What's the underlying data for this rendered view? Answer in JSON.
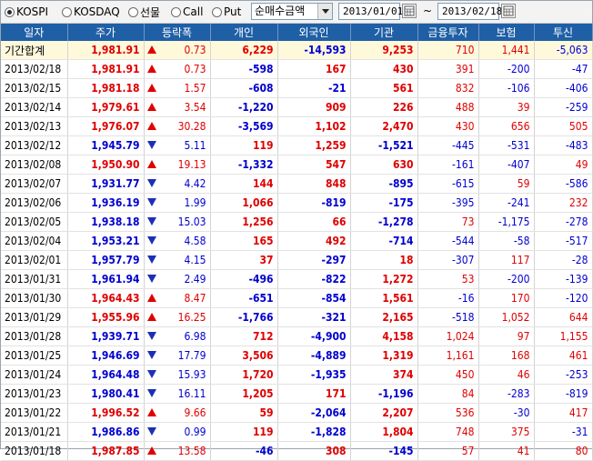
{
  "toolbar": {
    "markets": [
      {
        "label": "KOSPI",
        "selected": true
      },
      {
        "label": "KOSDAQ",
        "selected": false
      },
      {
        "label": "선물",
        "selected": false
      },
      {
        "label": "Call",
        "selected": false
      },
      {
        "label": "Put",
        "selected": false
      }
    ],
    "view_select": "순매수금액",
    "date_from": "2013/01/01",
    "date_sep": "~",
    "date_to": "2013/02/18"
  },
  "columns": [
    "일자",
    "주가",
    "등락폭",
    "개인",
    "외국인",
    "기관",
    "금융투자",
    "보험",
    "투신"
  ],
  "colors": {
    "up": "#e00000",
    "down": "#0000d0",
    "header_bg": "#1f5fa6",
    "total_bg": "#fff9dc"
  },
  "rows": [
    {
      "date": "기간합계",
      "price": "1,981.91",
      "dir": "up",
      "chg": "0.73",
      "indiv": "6,229",
      "foreign": "-14,593",
      "inst": "9,253",
      "fin": "710",
      "ins": "1,441",
      "trust": "-5,063"
    },
    {
      "date": "2013/02/18",
      "price": "1,981.91",
      "dir": "up",
      "chg": "0.73",
      "indiv": "-598",
      "foreign": "167",
      "inst": "430",
      "fin": "391",
      "ins": "-200",
      "trust": "-47"
    },
    {
      "date": "2013/02/15",
      "price": "1,981.18",
      "dir": "up",
      "chg": "1.57",
      "indiv": "-608",
      "foreign": "-21",
      "inst": "561",
      "fin": "832",
      "ins": "-106",
      "trust": "-406"
    },
    {
      "date": "2013/02/14",
      "price": "1,979.61",
      "dir": "up",
      "chg": "3.54",
      "indiv": "-1,220",
      "foreign": "909",
      "inst": "226",
      "fin": "488",
      "ins": "39",
      "trust": "-259"
    },
    {
      "date": "2013/02/13",
      "price": "1,976.07",
      "dir": "up",
      "chg": "30.28",
      "indiv": "-3,569",
      "foreign": "1,102",
      "inst": "2,470",
      "fin": "430",
      "ins": "656",
      "trust": "505"
    },
    {
      "date": "2013/02/12",
      "price": "1,945.79",
      "dir": "down",
      "chg": "5.11",
      "indiv": "119",
      "foreign": "1,259",
      "inst": "-1,521",
      "fin": "-445",
      "ins": "-531",
      "trust": "-483"
    },
    {
      "date": "2013/02/08",
      "price": "1,950.90",
      "dir": "up",
      "chg": "19.13",
      "indiv": "-1,332",
      "foreign": "547",
      "inst": "630",
      "fin": "-161",
      "ins": "-407",
      "trust": "49"
    },
    {
      "date": "2013/02/07",
      "price": "1,931.77",
      "dir": "down",
      "chg": "4.42",
      "indiv": "144",
      "foreign": "848",
      "inst": "-895",
      "fin": "-615",
      "ins": "59",
      "trust": "-586"
    },
    {
      "date": "2013/02/06",
      "price": "1,936.19",
      "dir": "down",
      "chg": "1.99",
      "indiv": "1,066",
      "foreign": "-819",
      "inst": "-175",
      "fin": "-395",
      "ins": "-241",
      "trust": "232"
    },
    {
      "date": "2013/02/05",
      "price": "1,938.18",
      "dir": "down",
      "chg": "15.03",
      "indiv": "1,256",
      "foreign": "66",
      "inst": "-1,278",
      "fin": "73",
      "ins": "-1,175",
      "trust": "-278"
    },
    {
      "date": "2013/02/04",
      "price": "1,953.21",
      "dir": "down",
      "chg": "4.58",
      "indiv": "165",
      "foreign": "492",
      "inst": "-714",
      "fin": "-544",
      "ins": "-58",
      "trust": "-517"
    },
    {
      "date": "2013/02/01",
      "price": "1,957.79",
      "dir": "down",
      "chg": "4.15",
      "indiv": "37",
      "foreign": "-297",
      "inst": "18",
      "fin": "-307",
      "ins": "117",
      "trust": "-28"
    },
    {
      "date": "2013/01/31",
      "price": "1,961.94",
      "dir": "down",
      "chg": "2.49",
      "indiv": "-496",
      "foreign": "-822",
      "inst": "1,272",
      "fin": "53",
      "ins": "-200",
      "trust": "-139"
    },
    {
      "date": "2013/01/30",
      "price": "1,964.43",
      "dir": "up",
      "chg": "8.47",
      "indiv": "-651",
      "foreign": "-854",
      "inst": "1,561",
      "fin": "-16",
      "ins": "170",
      "trust": "-120"
    },
    {
      "date": "2013/01/29",
      "price": "1,955.96",
      "dir": "up",
      "chg": "16.25",
      "indiv": "-1,766",
      "foreign": "-321",
      "inst": "2,165",
      "fin": "-518",
      "ins": "1,052",
      "trust": "644"
    },
    {
      "date": "2013/01/28",
      "price": "1,939.71",
      "dir": "down",
      "chg": "6.98",
      "indiv": "712",
      "foreign": "-4,900",
      "inst": "4,158",
      "fin": "1,024",
      "ins": "97",
      "trust": "1,155"
    },
    {
      "date": "2013/01/25",
      "price": "1,946.69",
      "dir": "down",
      "chg": "17.79",
      "indiv": "3,506",
      "foreign": "-4,889",
      "inst": "1,319",
      "fin": "1,161",
      "ins": "168",
      "trust": "461"
    },
    {
      "date": "2013/01/24",
      "price": "1,964.48",
      "dir": "down",
      "chg": "15.93",
      "indiv": "1,720",
      "foreign": "-1,935",
      "inst": "374",
      "fin": "450",
      "ins": "46",
      "trust": "-253"
    },
    {
      "date": "2013/01/23",
      "price": "1,980.41",
      "dir": "down",
      "chg": "16.11",
      "indiv": "1,205",
      "foreign": "171",
      "inst": "-1,196",
      "fin": "84",
      "ins": "-283",
      "trust": "-819"
    },
    {
      "date": "2013/01/22",
      "price": "1,996.52",
      "dir": "up",
      "chg": "9.66",
      "indiv": "59",
      "foreign": "-2,064",
      "inst": "2,207",
      "fin": "536",
      "ins": "-30",
      "trust": "417"
    },
    {
      "date": "2013/01/21",
      "price": "1,986.86",
      "dir": "down",
      "chg": "0.99",
      "indiv": "119",
      "foreign": "-1,828",
      "inst": "1,804",
      "fin": "748",
      "ins": "375",
      "trust": "-31"
    },
    {
      "date": "2013/01/18",
      "price": "1,987.85",
      "dir": "up",
      "chg": "13.58",
      "indiv": "-46",
      "foreign": "308",
      "inst": "-145",
      "fin": "57",
      "ins": "41",
      "trust": "80"
    }
  ]
}
